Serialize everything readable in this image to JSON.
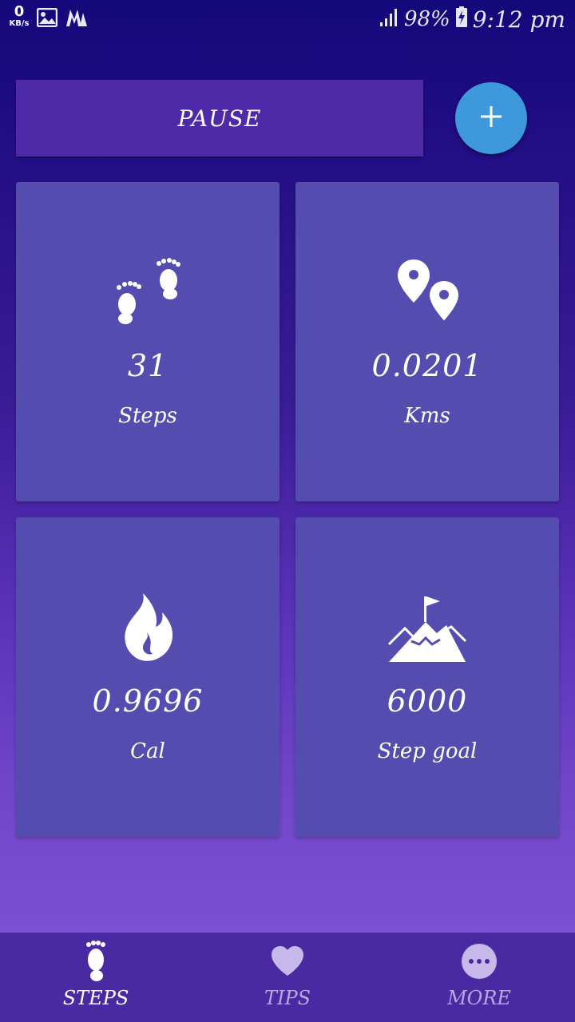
{
  "status_bar": {
    "network_speed": "0",
    "network_unit": "KB/s",
    "battery": "98%",
    "time": "9:12 pm",
    "icons": [
      "image-icon",
      "m-app-icon",
      "signal-icon",
      "battery-charging-icon"
    ]
  },
  "controls": {
    "pause_label": "PAUSE",
    "add_icon": "plus-icon"
  },
  "cards": [
    {
      "icon": "footprints-icon",
      "value": "31",
      "label": "Steps"
    },
    {
      "icon": "location-pins-icon",
      "value": "0.0201",
      "label": "Kms"
    },
    {
      "icon": "flame-icon",
      "value": "0.9696",
      "label": "Cal"
    },
    {
      "icon": "mountain-flag-icon",
      "value": "6000",
      "label": "Step goal"
    }
  ],
  "bottom_nav": {
    "items": [
      {
        "label": "STEPS",
        "icon": "footprint-icon",
        "active": true
      },
      {
        "label": "TIPS",
        "icon": "heart-icon",
        "active": false
      },
      {
        "label": "MORE",
        "icon": "more-dots-icon",
        "active": false
      }
    ]
  },
  "colors": {
    "accent": "#3d98dc",
    "card": "#544daf",
    "nav": "#4a2aa2"
  }
}
